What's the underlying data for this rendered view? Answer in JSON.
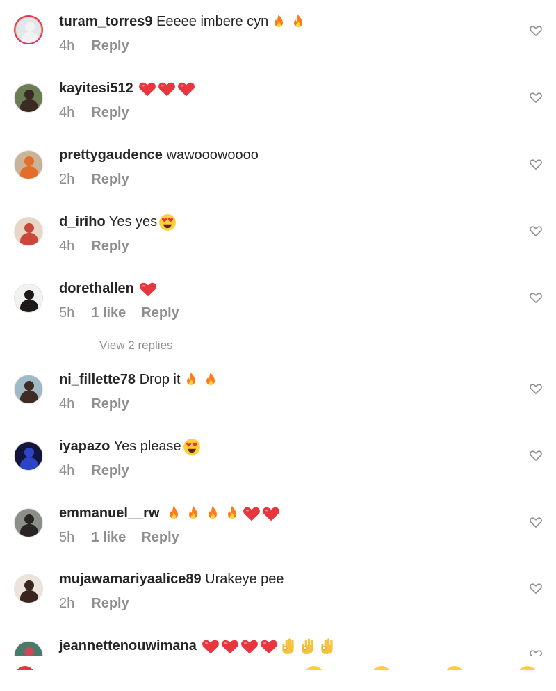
{
  "comments": [
    {
      "username": "turam_torres9",
      "text": "Eeeee imbere cyn",
      "emojis": [
        "fire",
        "fire"
      ],
      "time": "4h",
      "likes": "",
      "reply": "Reply",
      "avatar": {
        "bg": "#dfe7ef",
        "fg": "#f2f2f2",
        "ring": true
      }
    },
    {
      "username": "kayitesi512",
      "text": "",
      "emojis": [
        "heart",
        "heart",
        "heart"
      ],
      "time": "4h",
      "likes": "",
      "reply": "Reply",
      "avatar": {
        "bg": "#6b7d55",
        "fg": "#3a2a22",
        "ring": false
      }
    },
    {
      "username": "prettygaudence",
      "text": "wawooowoooo",
      "emojis": [],
      "time": "2h",
      "likes": "",
      "reply": "Reply",
      "avatar": {
        "bg": "#c9b49a",
        "fg": "#e36d2a",
        "ring": false
      }
    },
    {
      "username": "d_iriho",
      "text": "Yes yes",
      "emojis": [
        "star-eyes"
      ],
      "time": "4h",
      "likes": "",
      "reply": "Reply",
      "avatar": {
        "bg": "#e7d7c4",
        "fg": "#c9483a",
        "ring": false
      }
    },
    {
      "username": "dorethallen",
      "text": "",
      "emojis": [
        "heart"
      ],
      "time": "5h",
      "likes": "1 like",
      "reply": "Reply",
      "avatar": {
        "bg": "#f2f2f2",
        "fg": "#1f1a1a",
        "ring": false
      }
    },
    {
      "username": "ni_fillette78",
      "text": "Drop it",
      "emojis": [
        "fire",
        "fire"
      ],
      "time": "4h",
      "likes": "",
      "reply": "Reply",
      "avatar": {
        "bg": "#9fb9c6",
        "fg": "#3e2d24",
        "ring": false
      }
    },
    {
      "username": "iyapazo",
      "text": "Yes please",
      "emojis": [
        "star-eyes"
      ],
      "time": "4h",
      "likes": "",
      "reply": "Reply",
      "avatar": {
        "bg": "#12163d",
        "fg": "#2d44c7",
        "ring": false
      }
    },
    {
      "username": "emmanuel__rw",
      "text": "",
      "emojis": [
        "fire",
        "fire",
        "fire",
        "fire",
        "heart",
        "heart"
      ],
      "time": "5h",
      "likes": "1 like",
      "reply": "Reply",
      "avatar": {
        "bg": "#8b8f8a",
        "fg": "#2a2423",
        "ring": false
      }
    },
    {
      "username": "mujawamariyaalice89",
      "text": "Urakeye pee",
      "emojis": [],
      "time": "2h",
      "likes": "",
      "reply": "Reply",
      "avatar": {
        "bg": "#ece3dc",
        "fg": "#3a2420",
        "ring": false
      }
    },
    {
      "username": "jeannettenouwimana",
      "text": "",
      "emojis": [
        "heart",
        "heart",
        "heart",
        "heart",
        "ok-hand",
        "ok-hand",
        "ok-hand"
      ],
      "time": "",
      "likes": "",
      "reply": "",
      "avatar": {
        "bg": "#4a7a6a",
        "fg": "#c9495a",
        "ring": false
      }
    }
  ],
  "view_replies": "View 2 replies",
  "colors": {
    "primary_text": "#262626",
    "secondary_text": "#8e8e8e",
    "divider": "#dbdbdb",
    "heart": "#ed4956",
    "fire": "#ff7a1a"
  },
  "icons": {
    "like": "heart-outline-icon",
    "fire": "fire-emoji",
    "heart": "red-heart-emoji",
    "star_eyes": "heart-eyes-emoji",
    "ok_hand": "ok-hand-emoji"
  }
}
